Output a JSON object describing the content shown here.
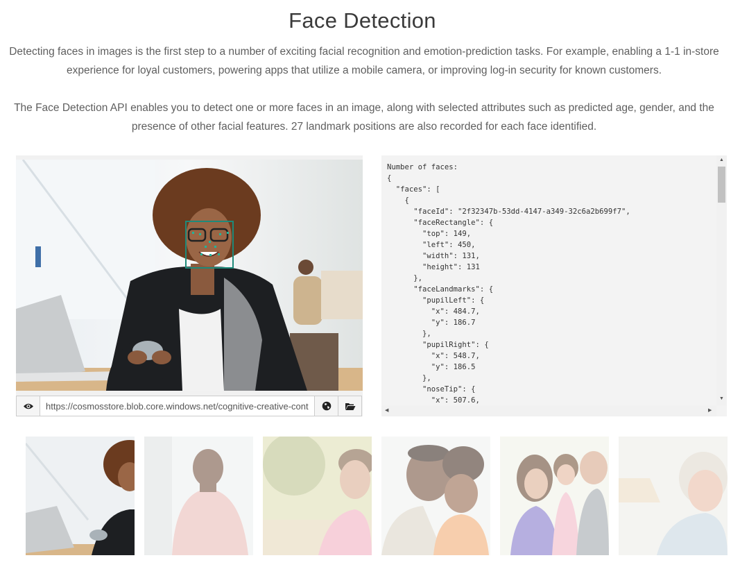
{
  "page": {
    "title": "Face Detection",
    "intro_1": "Detecting faces in images is the first step to a number of exciting facial recognition and emotion-prediction tasks. For example, enabling a 1-1 in-store experience for loyal customers, powering apps that utilize a mobile camera, or improving log-in security for known customers.",
    "intro_2": "The Face Detection API enables you to detect one or more faces in an image, along with selected attributes such as predicted age, gender, and the presence of other facial features. 27 landmark positions are also recorded for each face identified."
  },
  "image_panel": {
    "url_value": "https://cosmosstore.blob.core.windows.net/cognitive-creative-cont",
    "view_icon": "eye-icon",
    "globe_icon": "globe-icon",
    "folder_icon": "folder-open-icon",
    "accent_color": "#1e8a7a"
  },
  "result": {
    "json_text": "Number of faces:\n{\n  \"faces\": [\n    {\n      \"faceId\": \"2f32347b-53dd-4147-a349-32c6a2b699f7\",\n      \"faceRectangle\": {\n        \"top\": 149,\n        \"left\": 450,\n        \"width\": 131,\n        \"height\": 131\n      },\n      \"faceLandmarks\": {\n        \"pupilLeft\": {\n          \"x\": 484.7,\n          \"y\": 186.7\n        },\n        \"pupilRight\": {\n          \"x\": 548.7,\n          \"y\": 186.5\n        },\n        \"noseTip\": {\n          \"x\": 507.6,"
  },
  "thumbnails": [
    {
      "name": "woman-with-laptop",
      "active": true
    },
    {
      "name": "man-pink-shirt",
      "active": false
    },
    {
      "name": "man-glasses-outdoors",
      "active": false
    },
    {
      "name": "father-and-child",
      "active": false
    },
    {
      "name": "family-group",
      "active": false
    },
    {
      "name": "older-woman-smiling",
      "active": false
    }
  ]
}
